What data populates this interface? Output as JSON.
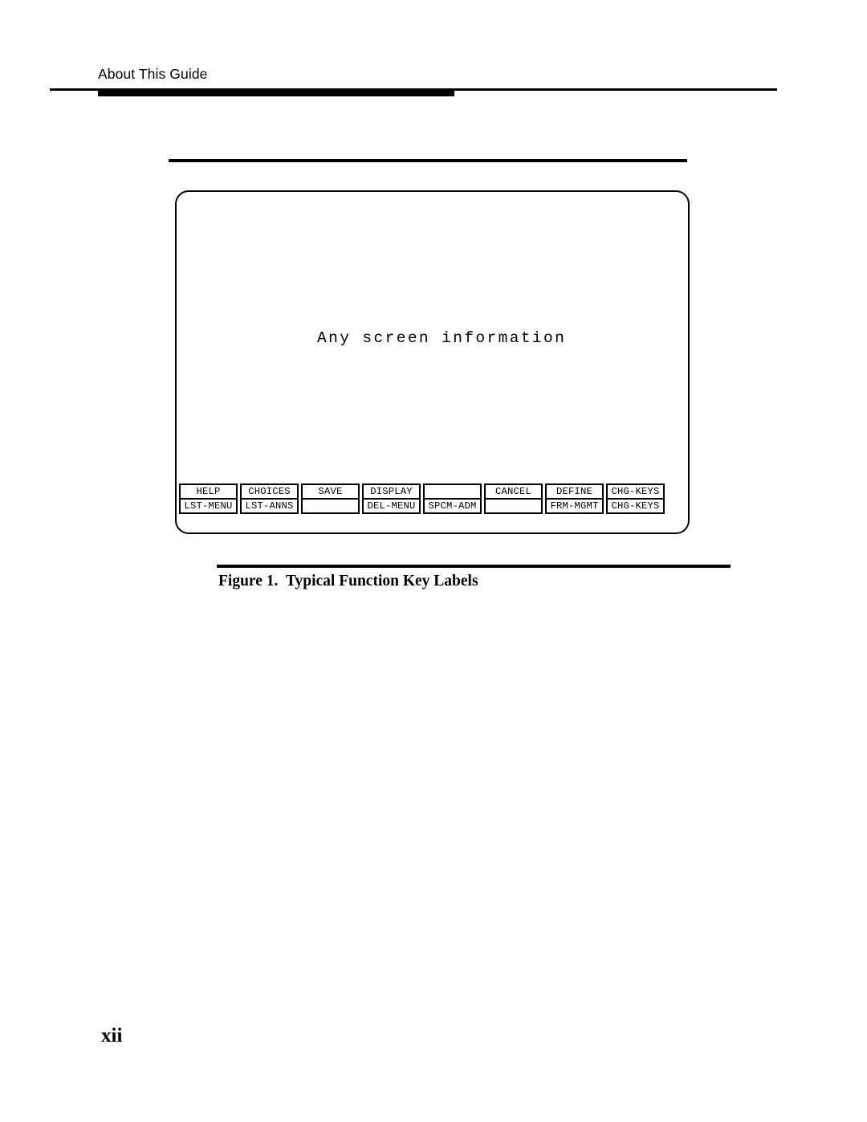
{
  "header": {
    "title": "About This Guide"
  },
  "figure": {
    "screen_text": "Any screen information",
    "caption_number": "Figure 1.",
    "caption_text": "Typical Function Key Labels",
    "function_keys": [
      {
        "top": "HELP",
        "bottom": "LST-MENU"
      },
      {
        "top": "CHOICES",
        "bottom": "LST-ANNS"
      },
      {
        "top": "SAVE",
        "bottom": ""
      },
      {
        "top": "DISPLAY",
        "bottom": "DEL-MENU"
      },
      {
        "top": "",
        "bottom": "SPCM-ADM"
      },
      {
        "top": "CANCEL",
        "bottom": ""
      },
      {
        "top": "DEFINE",
        "bottom": "FRM-MGMT"
      },
      {
        "top": "CHG-KEYS",
        "bottom": "CHG-KEYS"
      }
    ]
  },
  "folio": {
    "page_number": "xii"
  }
}
